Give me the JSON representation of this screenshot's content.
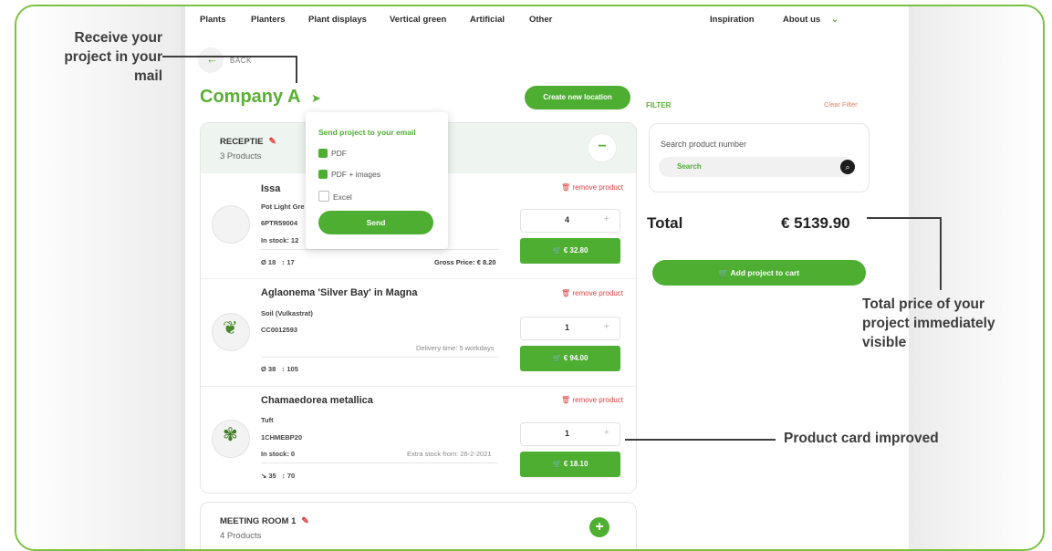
{
  "annotations": {
    "receive_project": {
      "line1": "Receive your",
      "line2": "project in your",
      "line3": "mail"
    },
    "total_price": {
      "line1": "Total price of your",
      "line2": "project immediately",
      "line3": "visible"
    },
    "product_card": "Product card improved"
  },
  "nav": {
    "items": [
      "Plants",
      "Planters",
      "Plant displays",
      "Vertical green",
      "Artificial",
      "Other"
    ],
    "right": [
      "Inspiration",
      "About us"
    ]
  },
  "back_label": "BACK",
  "company": "Company A",
  "create_location": "Create new location",
  "popup": {
    "title": "Send project to your email",
    "options": [
      {
        "label": "PDF",
        "checked": true
      },
      {
        "label": "PDF + images",
        "checked": true
      },
      {
        "label": "Excel",
        "checked": false
      }
    ],
    "send": "Send"
  },
  "location": {
    "title": "RECEPTIE",
    "count": "3 Products"
  },
  "products": [
    {
      "name": "Issa",
      "line1": "Pot Light Gre",
      "line2": "6PTR59004",
      "stock": "In stock: 12",
      "diam": "Ø 18",
      "height": "↕ 17",
      "note": "Gross Price: € 8.20",
      "remove": "remove product",
      "qty": "4",
      "price": "€ 32.80",
      "icon": "planter-pot-icon"
    },
    {
      "name": "Aglaonema 'Silver Bay' in Magna",
      "line1": "Soil (Vulkastrat)",
      "line2": "CC0012593",
      "stock": "",
      "diam": "Ø 38",
      "height": "↕ 105",
      "note": "Delivery time: 5 workdays",
      "remove": "remove product",
      "qty": "1",
      "price": "€ 94.00",
      "icon": "plant-icon"
    },
    {
      "name": "Chamaedorea metallica",
      "line1": "Tuft",
      "line2": "1CHMEBP20",
      "stock": "In stock: 0",
      "diam": "↘ 35",
      "height": "↕ 70",
      "note": "Extra stock from: 26-2-2021",
      "remove": "remove product",
      "qty": "1",
      "price": "€ 18.10",
      "icon": "plant-icon"
    }
  ],
  "filter": {
    "label": "FILTER",
    "clear": "Clear Filter",
    "search_placeholder": "Search product number",
    "search_button": "Search"
  },
  "total": {
    "label": "Total",
    "value": "€ 5139.90"
  },
  "add_to_cart": "Add project to cart",
  "meeting": {
    "title": "MEETING ROOM 1",
    "count": "4 Products"
  },
  "colors": {
    "accent": "#4dae32",
    "danger": "#e04040",
    "frame": "#7bc142"
  }
}
